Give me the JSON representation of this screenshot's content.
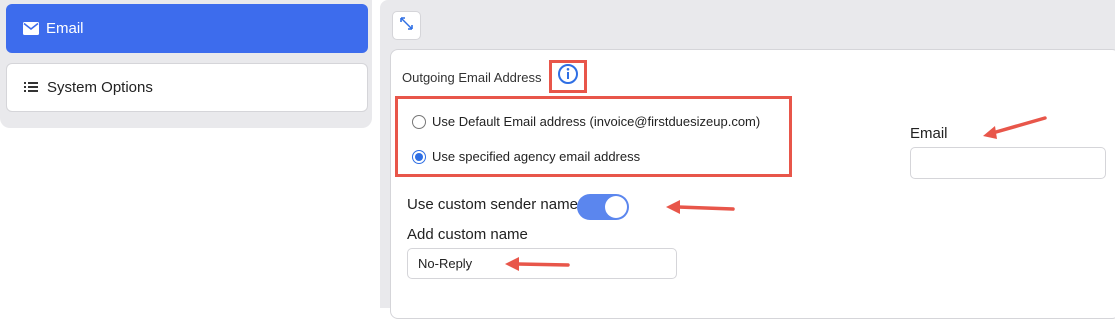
{
  "sidebar": {
    "items": [
      {
        "label": "Email",
        "icon": "envelope-icon",
        "active": true
      },
      {
        "label": "System Options",
        "icon": "list-icon",
        "active": false
      }
    ]
  },
  "toolbar": {
    "expand_icon": "expand-icon"
  },
  "form": {
    "outgoing_label": "Outgoing Email Address",
    "info_icon": "info-icon",
    "radio_options": [
      {
        "label": "Use Default Email address (invoice@firstduesizeup.com)",
        "checked": false
      },
      {
        "label": "Use specified agency email address",
        "checked": true
      }
    ],
    "email_label": "Email",
    "email_value": "",
    "sender_name_label": "Use custom sender name",
    "sender_name_enabled": true,
    "custom_name_label": "Add custom name",
    "custom_name_value": "No-Reply"
  },
  "colors": {
    "accent": "#3d6ced",
    "toggle": "#5b86ee",
    "annotation": "#e8564a",
    "radio_checked": "#2f6fe4"
  }
}
